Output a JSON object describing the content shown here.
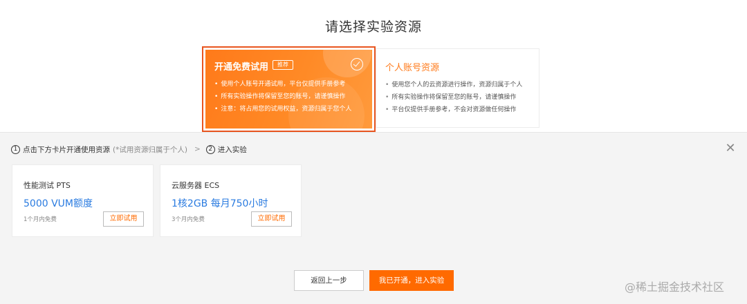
{
  "title": "请选择实验资源",
  "options": {
    "trial": {
      "title": "开通免费试用",
      "badge": "推荐",
      "items": [
        "使用个人账号开通试用，平台仅提供手册参考",
        "所有实验操作将保留至您的账号，请谨慎操作",
        "注意：将占用您的试用权益，资源归属于您个人"
      ],
      "selected": true
    },
    "personal": {
      "title": "个人账号资源",
      "items": [
        "使用您个人的云资源进行操作，资源归属于个人",
        "所有实验操作将保留至您的账号，请谨慎操作",
        "平台仅提供手册参考，不会对资源做任何操作"
      ]
    }
  },
  "steps": {
    "step1_num": "1",
    "step1_label": "点击下方卡片开通使用资源",
    "step1_note": "(*试用资源归属于个人)",
    "arrow": ">",
    "step2_num": "2",
    "step2_label": "进入实验"
  },
  "cards": [
    {
      "name": "性能测试 PTS",
      "value": "5000 VUM额度",
      "free": "1个月内免费",
      "button": "立即试用"
    },
    {
      "name": "云服务器 ECS",
      "value": "1核2GB 每月750小时",
      "free": "3个月内免费",
      "button": "立即试用"
    }
  ],
  "buttons": {
    "back": "返回上一步",
    "confirm": "我已开通，进入实验"
  },
  "watermark": "@稀土掘金技术社区",
  "colors": {
    "accent": "#ff6a00",
    "value_blue": "#2a7be0",
    "selected_border": "#e8541e"
  }
}
